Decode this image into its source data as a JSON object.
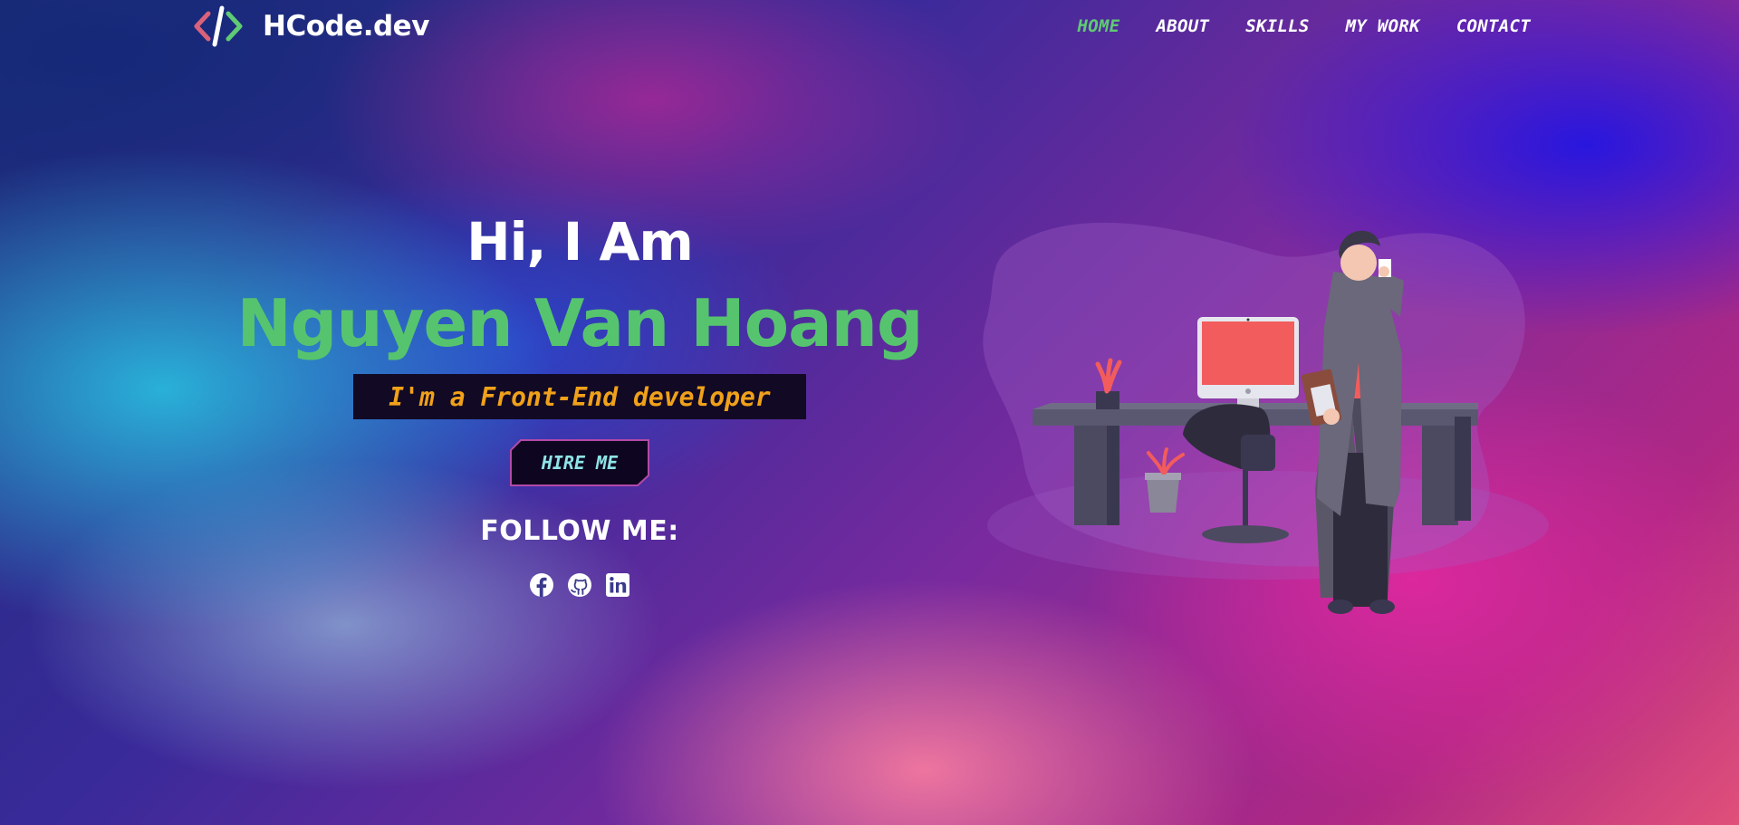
{
  "brand": {
    "name": "HCode.dev"
  },
  "nav": {
    "items": [
      {
        "label": "HOME",
        "active": true
      },
      {
        "label": "ABOUT",
        "active": false
      },
      {
        "label": "SKILLS",
        "active": false
      },
      {
        "label": "MY WORK",
        "active": false
      },
      {
        "label": "CONTACT",
        "active": false
      }
    ],
    "active_color": "#5fcb74"
  },
  "hero": {
    "greeting": "Hi, I Am",
    "name": "Nguyen Van Hoang",
    "role": "I'm a Front-End developer",
    "cta_label": "HIRE ME",
    "follow_title": "FOLLOW ME:",
    "socials": [
      {
        "icon": "facebook-icon"
      },
      {
        "icon": "github-icon"
      },
      {
        "icon": "linkedin-icon"
      }
    ]
  },
  "colors": {
    "name_green": "#56c46e",
    "role_orange": "#f0a11a",
    "cta_text": "#8fe3e6",
    "accent_pink": "#f25c5c"
  }
}
